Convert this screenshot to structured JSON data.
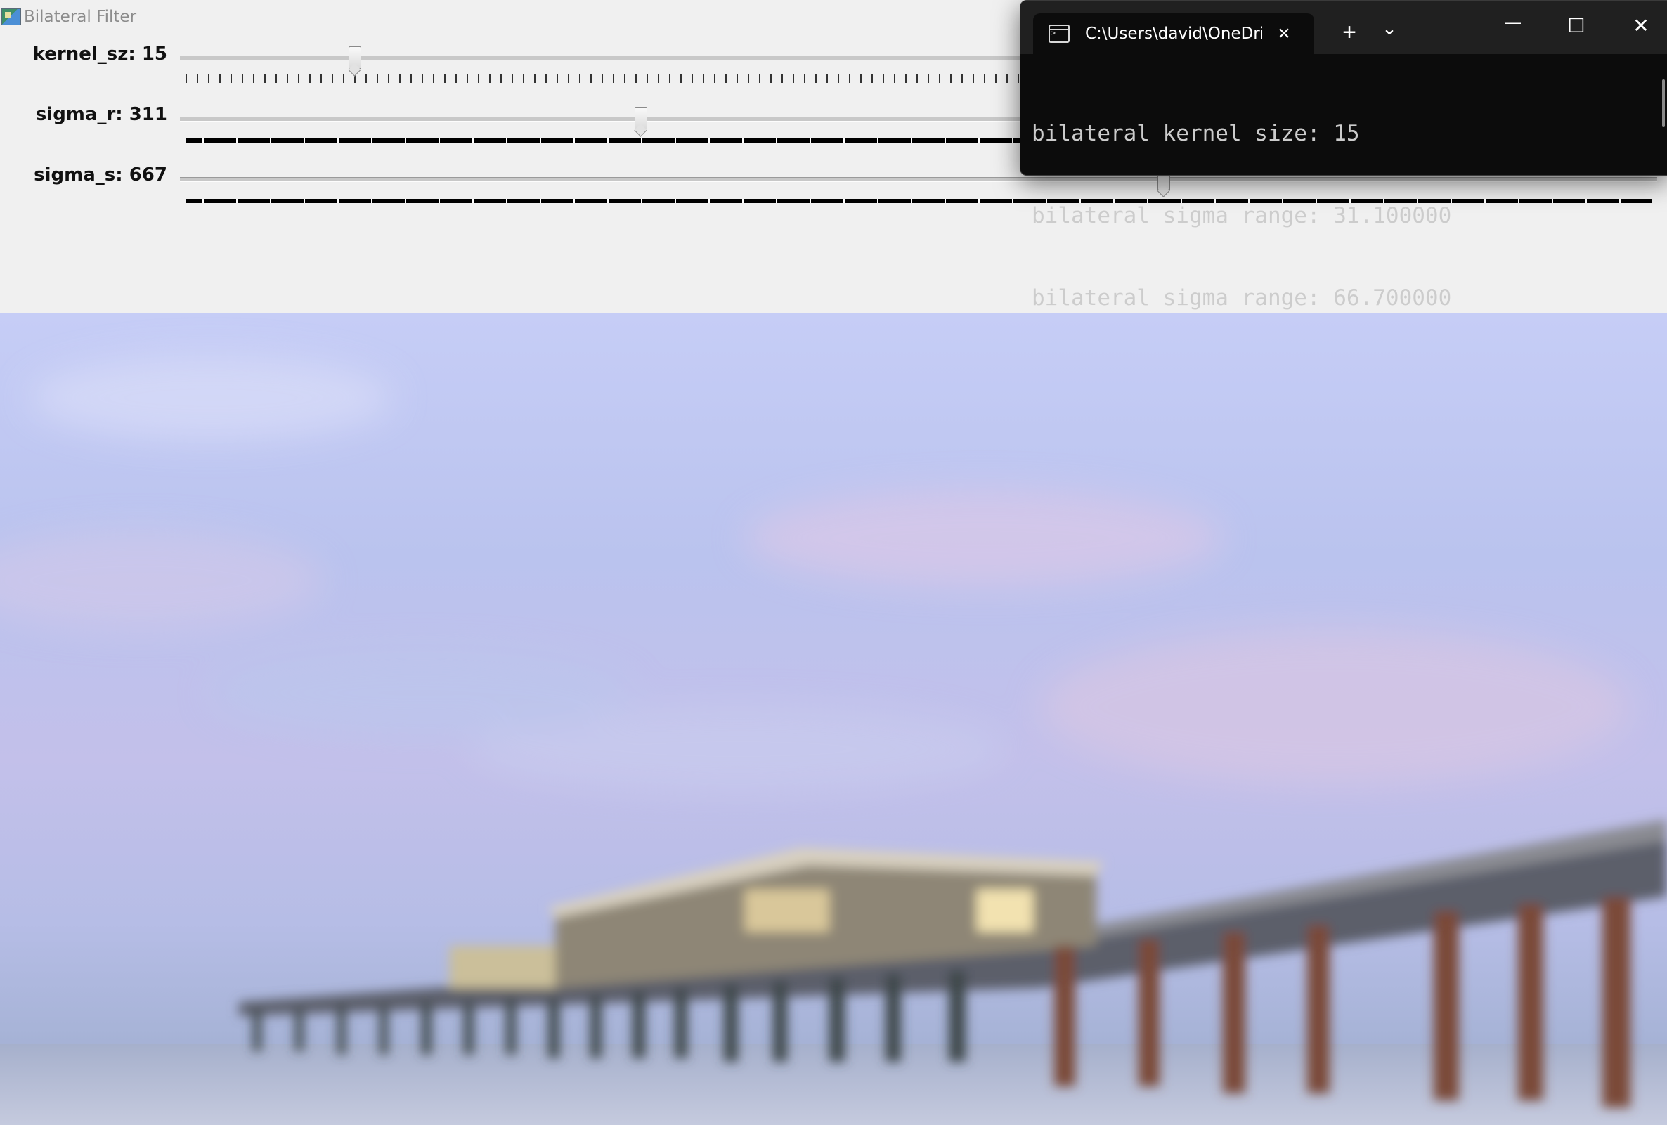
{
  "window": {
    "title": "Bilateral Filter",
    "icon": "opencv-app-icon"
  },
  "trackbars": [
    {
      "label": "kernel_sz: 15",
      "value": 15,
      "position_fraction": 0.115,
      "tick_style": "dotted"
    },
    {
      "label": "sigma_r: 311",
      "value": 311,
      "position_fraction": 0.31,
      "tick_style": "dashed"
    },
    {
      "label": "sigma_s: 667",
      "value": 667,
      "position_fraction": 0.667,
      "tick_style": "dashed"
    }
  ],
  "image": {
    "subject": "blurred-pier-over-ocean"
  },
  "terminal": {
    "tab_title": "C:\\Users\\david\\OneDri",
    "tab_icon": "terminal-icon",
    "tab_close": "×",
    "new_tab": "+",
    "dropdown": "⌄",
    "minimize": "—",
    "maximize": "☐",
    "close": "✕",
    "lines": [
      "bilateral kernel size: 15",
      "bilateral sigma range: 31.100000",
      "bilateral sigma range: 66.700000"
    ]
  },
  "colors": {
    "terminal_bg": "#0c0c0c",
    "terminal_text": "#cccccc",
    "panel_bg": "#f0f0f0"
  }
}
